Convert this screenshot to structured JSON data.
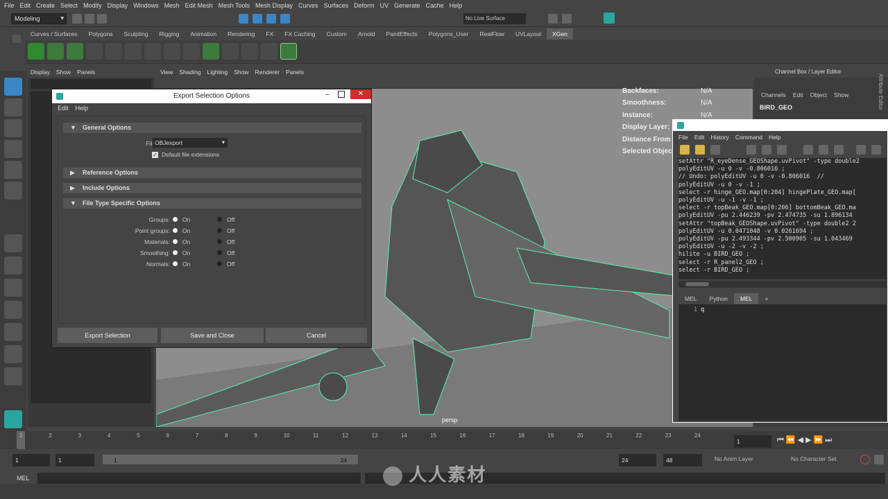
{
  "menubar": [
    "File",
    "Edit",
    "Create",
    "Select",
    "Modify",
    "Display",
    "Windows",
    "Mesh",
    "Edit Mesh",
    "Mesh Tools",
    "Mesh Display",
    "Curves",
    "Surfaces",
    "Deform",
    "UV",
    "Generate",
    "Cache",
    "Help"
  ],
  "status": {
    "mode": "Modeling",
    "live_surface": "No Live Surface"
  },
  "shelf_tabs": [
    "Curves / Surfaces",
    "Polygons",
    "Sculpting",
    "Rigging",
    "Animation",
    "Rendering",
    "FX",
    "FX Caching",
    "Custom",
    "Arnold",
    "PaintEffects",
    "Polygons_User",
    "RealFlow",
    "UVLayout",
    "XGen"
  ],
  "active_shelf": "XGen",
  "outliner": {
    "menu": [
      "Display",
      "Show",
      "Panels"
    ]
  },
  "viewport": {
    "menu": [
      "View",
      "Shading",
      "Lighting",
      "Show",
      "Renderer",
      "Panels"
    ],
    "camera": "persp",
    "hud": [
      {
        "label": "Backfaces:",
        "value": "N/A"
      },
      {
        "label": "Smoothness:",
        "value": "N/A"
      },
      {
        "label": "Instance:",
        "value": "N/A"
      },
      {
        "label": "Display Layer:",
        "value": "N/A"
      },
      {
        "label": "Distance From",
        "value": ""
      },
      {
        "label": "Selected Objec",
        "value": ""
      }
    ]
  },
  "channelbox": {
    "title": "Channel Box / Layer Editor",
    "menu": [
      "Channels",
      "Edit",
      "Object",
      "Show"
    ],
    "object": "BIRD_GEO",
    "side_tab": "Attribute Editor"
  },
  "dialog": {
    "title": "Export Selection Options",
    "menu": [
      "Edit",
      "Help"
    ],
    "general": "General Options",
    "filetype_label": "File type:",
    "filetype": "OBJexport",
    "default_ext": "Default file extensions",
    "reference": "Reference Options",
    "include": "Include Options",
    "specific": "File Type Specific Options",
    "options": [
      {
        "label": "Groups:",
        "on": "On",
        "off": "Off"
      },
      {
        "label": "Point groups:",
        "on": "On",
        "off": "Off"
      },
      {
        "label": "Materials:",
        "on": "On",
        "off": "Off"
      },
      {
        "label": "Smoothing:",
        "on": "On",
        "off": "Off"
      },
      {
        "label": "Normals:",
        "on": "On",
        "off": "Off"
      }
    ],
    "buttons": [
      "Export Selection",
      "Save and Close",
      "Cancel"
    ]
  },
  "script_editor": {
    "menu": [
      "File",
      "Edit",
      "History",
      "Command",
      "Help"
    ],
    "lines": [
      "setAttr \"R_eyeDense_GEOShape.uvPivot\" -type double2",
      "polyEditUV -u 0 -v -0.806016 ;",
      "// Undo: polyEditUV -u 0 -v -0.806016  //",
      "polyEditUV -u 0 -v -1 ;",
      "select -r hinge_GEO.map[0:204] hingePlate_GEO.map[",
      "polyEditUV -u -1 -v -1 ;",
      "select -r topBeak_GEO.map[0:206] bottomBeak_GEO.ma",
      "polyEditUV -pu 2.446239 -pv 2.474735 -su 1.896134",
      "setAttr \"topBeak_GEOShape.uvPivot\" -type double2 2",
      "polyEditUV -u 0.0471048 -v 0.0261694 ;",
      "polyEditUV -pu 2.493344 -pv 2.500905 -su 1.043469",
      "polyEditUV -u -2 -v -2 ;",
      "hilite -u BIRD_GEO ;",
      "select -r R_panel2_GEO ;",
      "select -r BIRD_GEO ;"
    ],
    "tabs": [
      "MEL",
      "Python",
      "MEL",
      "+"
    ],
    "line_no": "1",
    "input": "q"
  },
  "timeline": {
    "ticks": [
      "1",
      "2",
      "3",
      "4",
      "5",
      "6",
      "7",
      "8",
      "9",
      "10",
      "11",
      "12",
      "13",
      "14",
      "15",
      "16",
      "17",
      "18",
      "19",
      "20",
      "21",
      "22",
      "23",
      "24"
    ],
    "current": "1"
  },
  "range": {
    "start": "1",
    "playstart": "1",
    "slider_start": "1",
    "slider_end": "24",
    "playend": "24",
    "end": "48",
    "anim_layer": "No Anim Layer",
    "character": "No Character Set"
  },
  "cmdline": {
    "label": "MEL"
  },
  "watermark": "人人素材"
}
